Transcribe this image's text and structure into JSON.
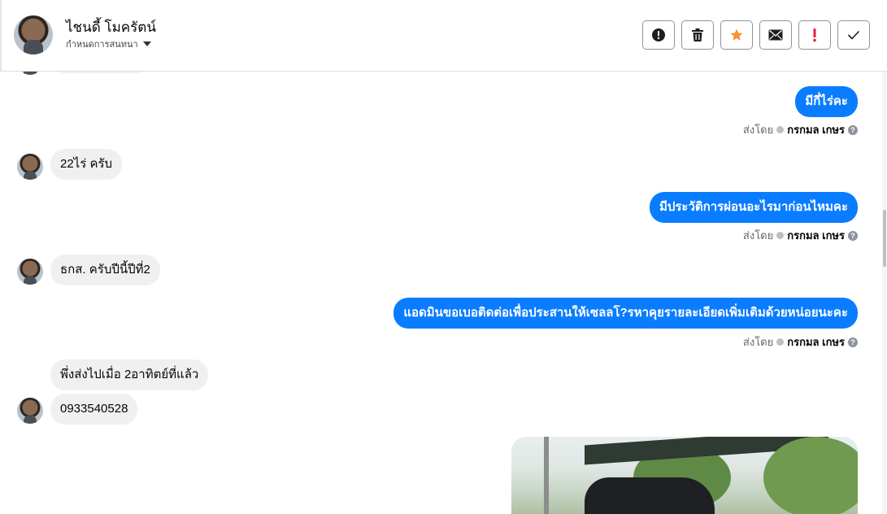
{
  "header": {
    "contact_name": "ไชนดี้ โมครัตน์",
    "assign_label": "กำหนดการสนทนา",
    "actions": [
      {
        "name": "report-button",
        "icon": "alert-circle-icon"
      },
      {
        "name": "delete-button",
        "icon": "trash-icon"
      },
      {
        "name": "star-button",
        "icon": "star-icon"
      },
      {
        "name": "mark-unread-button",
        "icon": "envelope-icon"
      },
      {
        "name": "spam-button",
        "icon": "exclamation-icon"
      },
      {
        "name": "done-button",
        "icon": "check-icon"
      }
    ]
  },
  "colors": {
    "accent": "#0a7cff",
    "star": "#f7923a",
    "spam": "#e41e3f",
    "incoming_bubble": "#f0f0f0"
  },
  "messages": {
    "out1": "มีกี่ไร่คะ",
    "in1": "22ไร่ ครับ",
    "out2": "มีประวัติการผ่อนอะไรมาก่อนไหมคะ",
    "in2": "ธกส. ครับปีนี้ปีที่2",
    "out3": "แอดมินขอเบอติดต่อเพื่อประสานให้เซลลโ?รหาคุยรายละเอียดเพิ่มเติมด้วยหน่อยนะคะ",
    "in3": "พึ่งส่งไปเมื่อ 2อาทิตย์ที่แล้ว",
    "in4": "0933540528"
  },
  "sent_by": {
    "prefix": "ส่งโดย",
    "agent": "กรกมล เกษร",
    "help": "?"
  }
}
